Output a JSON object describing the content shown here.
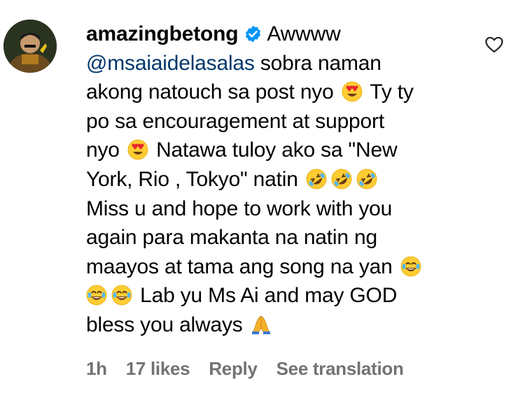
{
  "comment": {
    "username": "amazingbetong",
    "text_start": "Awwww",
    "mention": "@msaiaidelasalas",
    "line_1_after_mention": " sobra naman",
    "line_2": "akong natouch sa post nyo",
    "line_2b": "Ty ty",
    "line_3": "po sa encouragement at support",
    "line_4a": "nyo",
    "line_4b": "Natawa tuloy ako sa \"New",
    "line_5": "York, Rio , Tokyo\" natin",
    "line_6": "Miss u and hope to work with you",
    "line_7": "again para makanta na natin ng",
    "line_8": "maayos at tama ang song na yan",
    "line_9": "Lab yu Ms Ai and may GOD",
    "line_10": "bless you always"
  },
  "meta": {
    "time": "1h",
    "likes": "17 likes",
    "reply": "Reply",
    "translate": "See translation"
  },
  "icons": {
    "verified": "verified-badge-icon",
    "heart": "heart-outline-icon",
    "emoji_heart_eyes": "heart-eyes-emoji",
    "emoji_rofl": "rolling-laughing-emoji",
    "emoji_joy": "tears-of-joy-emoji",
    "emoji_pray": "folded-hands-emoji"
  },
  "colors": {
    "mention": "#00376b",
    "verified": "#0095f6",
    "meta": "#737373"
  }
}
